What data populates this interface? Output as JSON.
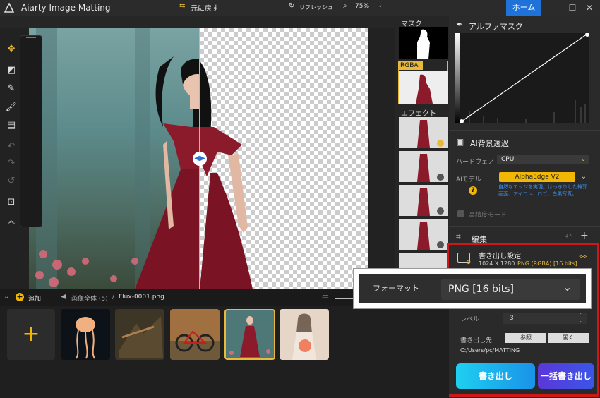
{
  "titlebar": {
    "app_title": "Aiarty Image Matting",
    "home_label": "ホーム",
    "minimize": "—",
    "maximize": "☐",
    "close": "✕"
  },
  "canvas_toolbar": {
    "undo_label": "元に戻す",
    "refresh_label": "リフレッシュ",
    "zoom": "75%"
  },
  "right_thumbs": {
    "mask_label": "マスク",
    "rgba_label": "RGBA",
    "effect_label": "エフェクト"
  },
  "panel": {
    "alpha_mask": {
      "title": "アルファマスク"
    },
    "ai_bg": {
      "title": "AI背景透過",
      "hardware_label": "ハードウェア",
      "hardware_value": "CPU",
      "model_label": "AIモデル",
      "model_value": "AlphaEdge  V2",
      "model_desc": "自然なエッジを実現。はっきりした輪郭画面、アイコン、ロゴ、白黒写真。",
      "hq_label": "高精度モード"
    },
    "edit": {
      "title": "編集"
    },
    "export": {
      "title": "書き出し設定",
      "size": "1024 X 1280",
      "format_summary": "PNG (RGBA) [16 bits]",
      "level_label": "レベル",
      "level_value": "3",
      "dest_label": "書き出し先",
      "browse_label": "参照",
      "open_label": "開く",
      "path": "C:/Users/pc/MATTING",
      "export_button": "書き出し",
      "batch_button": "一括書き出し"
    }
  },
  "format_popup": {
    "label": "フォーマット",
    "value": "PNG   [16 bits]"
  },
  "bottom_bar": {
    "add_label": "追加",
    "breadcrumb_all": "画像全体 (5)",
    "breadcrumb_sep": "/",
    "breadcrumb_file": "Flux-0001.png"
  },
  "colors": {
    "accent": "#1f73d8",
    "highlight": "#e8b93a",
    "red_outline": "#d01616"
  }
}
